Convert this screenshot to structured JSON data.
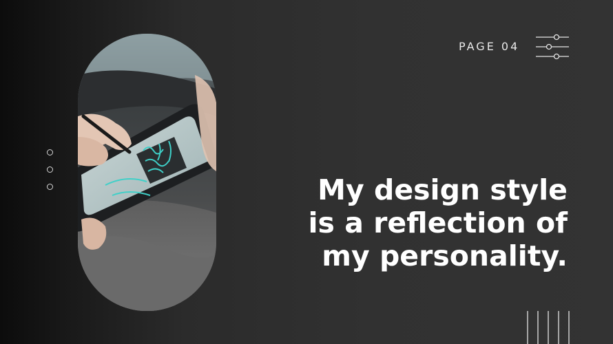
{
  "header": {
    "page_label": "PAGE 04",
    "icon": "sliders-icon"
  },
  "side_dots": {
    "count": 3
  },
  "photo": {
    "subject_icon": "tablet-drawing-photo"
  },
  "quote": {
    "lines": [
      "My design style",
      "is a reflection of",
      "my personality."
    ]
  },
  "decor": {
    "bottom_icon": "vertical-lines-icon"
  },
  "colors": {
    "background": "#333333",
    "background_dark": "#0c0c0c",
    "text": "#ffffff",
    "accent_line": "#d8d8d8"
  }
}
